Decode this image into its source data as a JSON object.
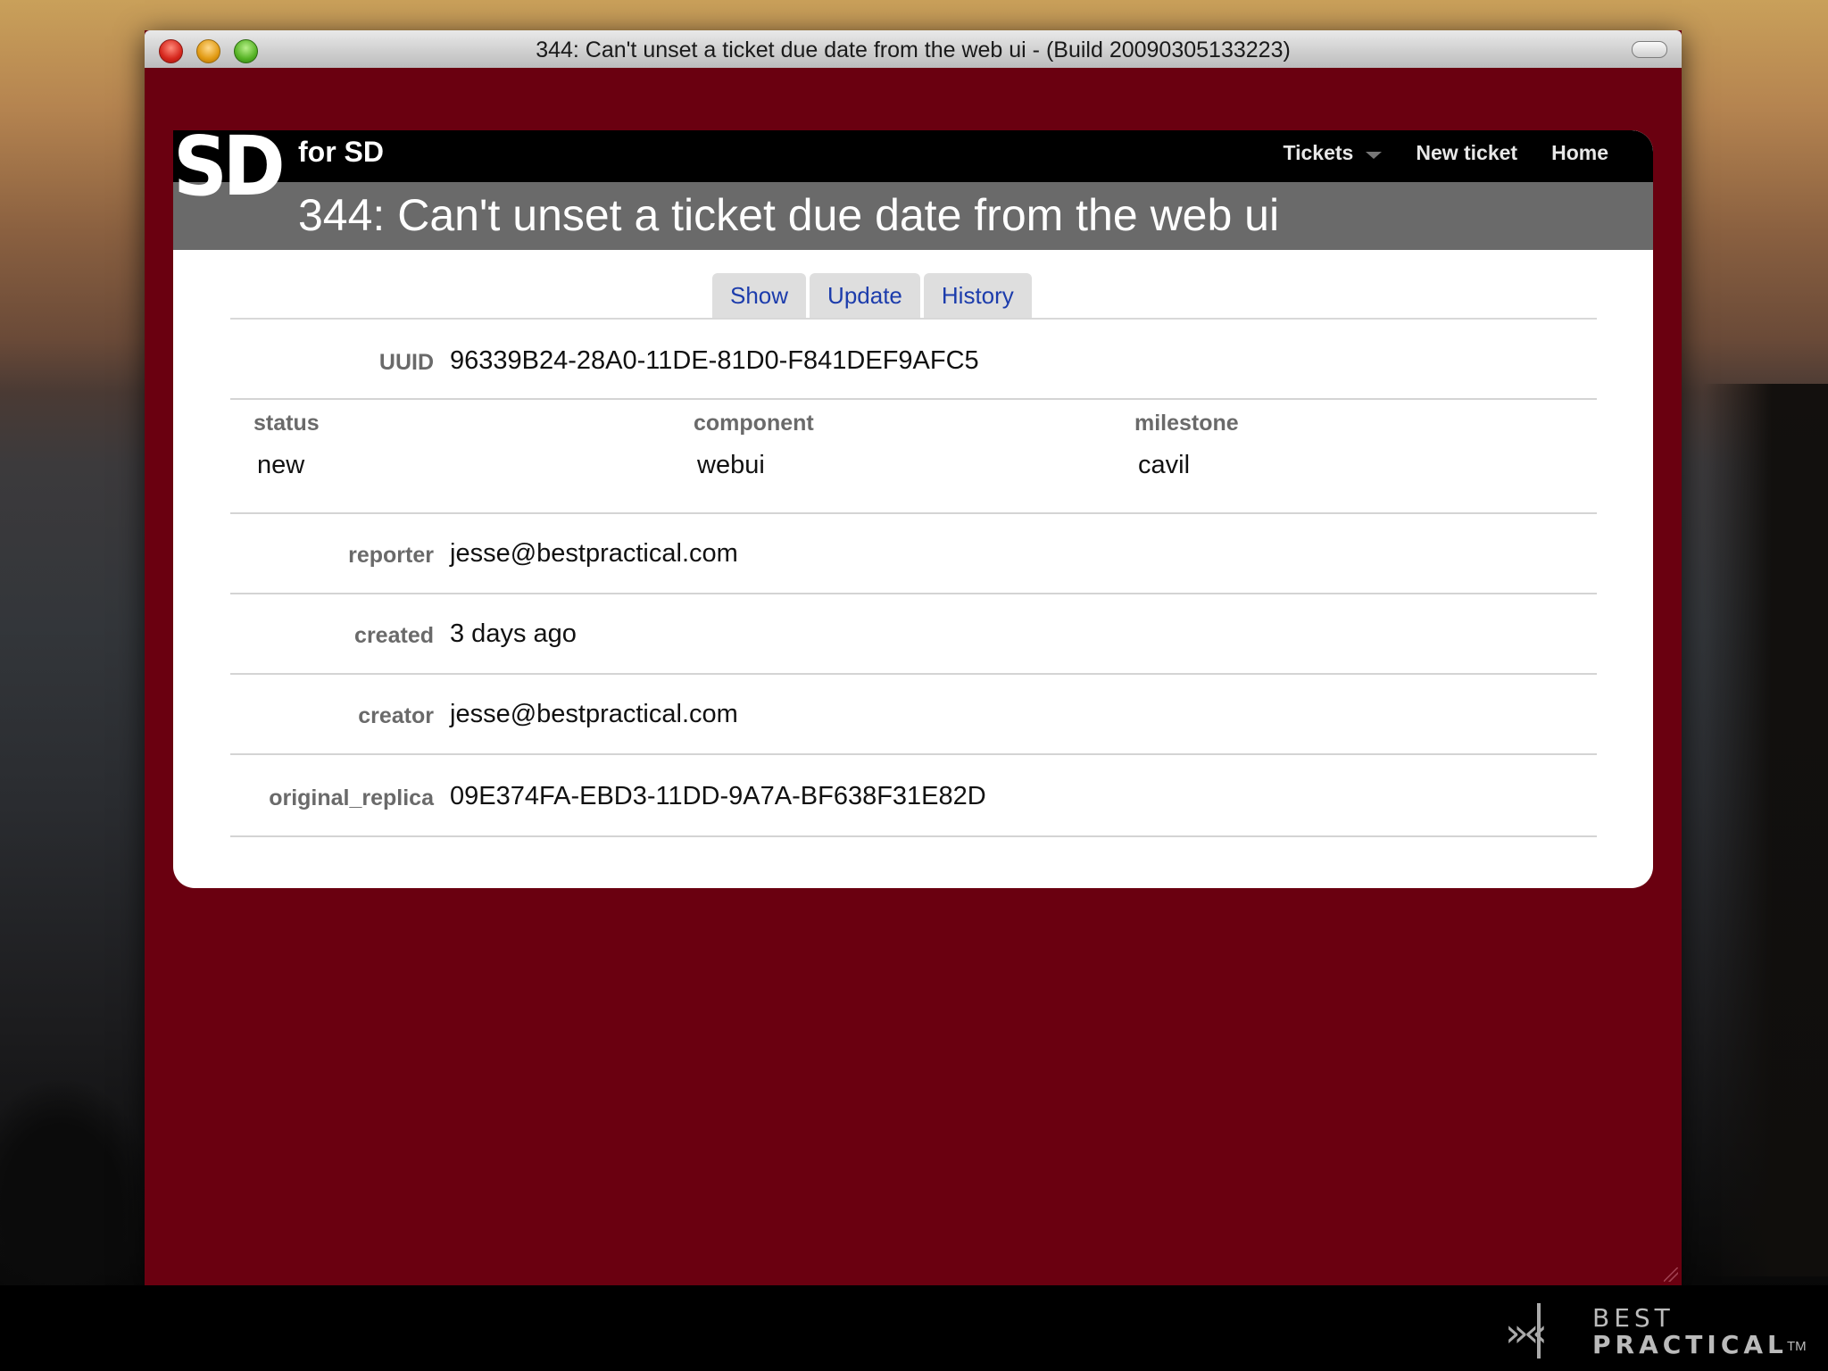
{
  "window": {
    "title": "344: Can't unset a ticket due date from the web ui - (Build 20090305133223)"
  },
  "header": {
    "logo": "SD",
    "app_name": "for SD",
    "nav": {
      "tickets": "Tickets",
      "new_ticket": "New ticket",
      "home": "Home"
    },
    "ticket_title": "344: Can't unset a ticket due date from the web ui"
  },
  "tabs": [
    {
      "label": "Show"
    },
    {
      "label": "Update"
    },
    {
      "label": "History"
    }
  ],
  "fields": {
    "uuid": {
      "label": "UUID",
      "value": "96339B24-28A0-11DE-81D0-F841DEF9AFC5"
    },
    "status": {
      "label": "status",
      "value": "new"
    },
    "component": {
      "label": "component",
      "value": "webui"
    },
    "milestone": {
      "label": "milestone",
      "value": "cavil"
    },
    "reporter": {
      "label": "reporter",
      "value": "jesse@bestpractical.com"
    },
    "created": {
      "label": "created",
      "value": "3 days ago"
    },
    "creator": {
      "label": "creator",
      "value": "jesse@bestpractical.com"
    },
    "original_replica": {
      "label": "original_replica",
      "value": "09E374FA-EBD3-11DD-9A7A-BF638F31E82D"
    }
  },
  "brand": {
    "line1": "BEST",
    "line2": "PRACTICAL",
    "tm": "TM"
  },
  "colors": {
    "window_bg": "#6a0010",
    "tab_text": "#1c3cac",
    "title_band": "#6a6a6a"
  }
}
